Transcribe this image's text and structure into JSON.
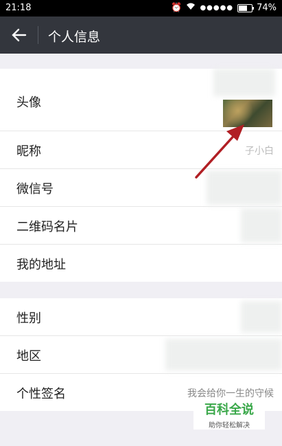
{
  "status_bar": {
    "time": "21:18",
    "battery": "74%"
  },
  "header": {
    "title": "个人信息"
  },
  "group1": [
    {
      "label": "头像",
      "value": ""
    },
    {
      "label": "昵称",
      "value": "子小白"
    },
    {
      "label": "微信号",
      "value": ""
    },
    {
      "label": "二维码名片",
      "value": ""
    },
    {
      "label": "我的地址",
      "value": ""
    }
  ],
  "group2": [
    {
      "label": "性别",
      "value": ""
    },
    {
      "label": "地区",
      "value": ""
    },
    {
      "label": "个性签名",
      "value": "我会给你一生的守候"
    }
  ],
  "watermark": {
    "main": "百科全说",
    "sub": "助你轻松解决"
  },
  "colors": {
    "header_bg": "#33363d",
    "background": "#f0eff4",
    "arrow": "#b11f24",
    "watermark_green": "#3aa84a"
  }
}
